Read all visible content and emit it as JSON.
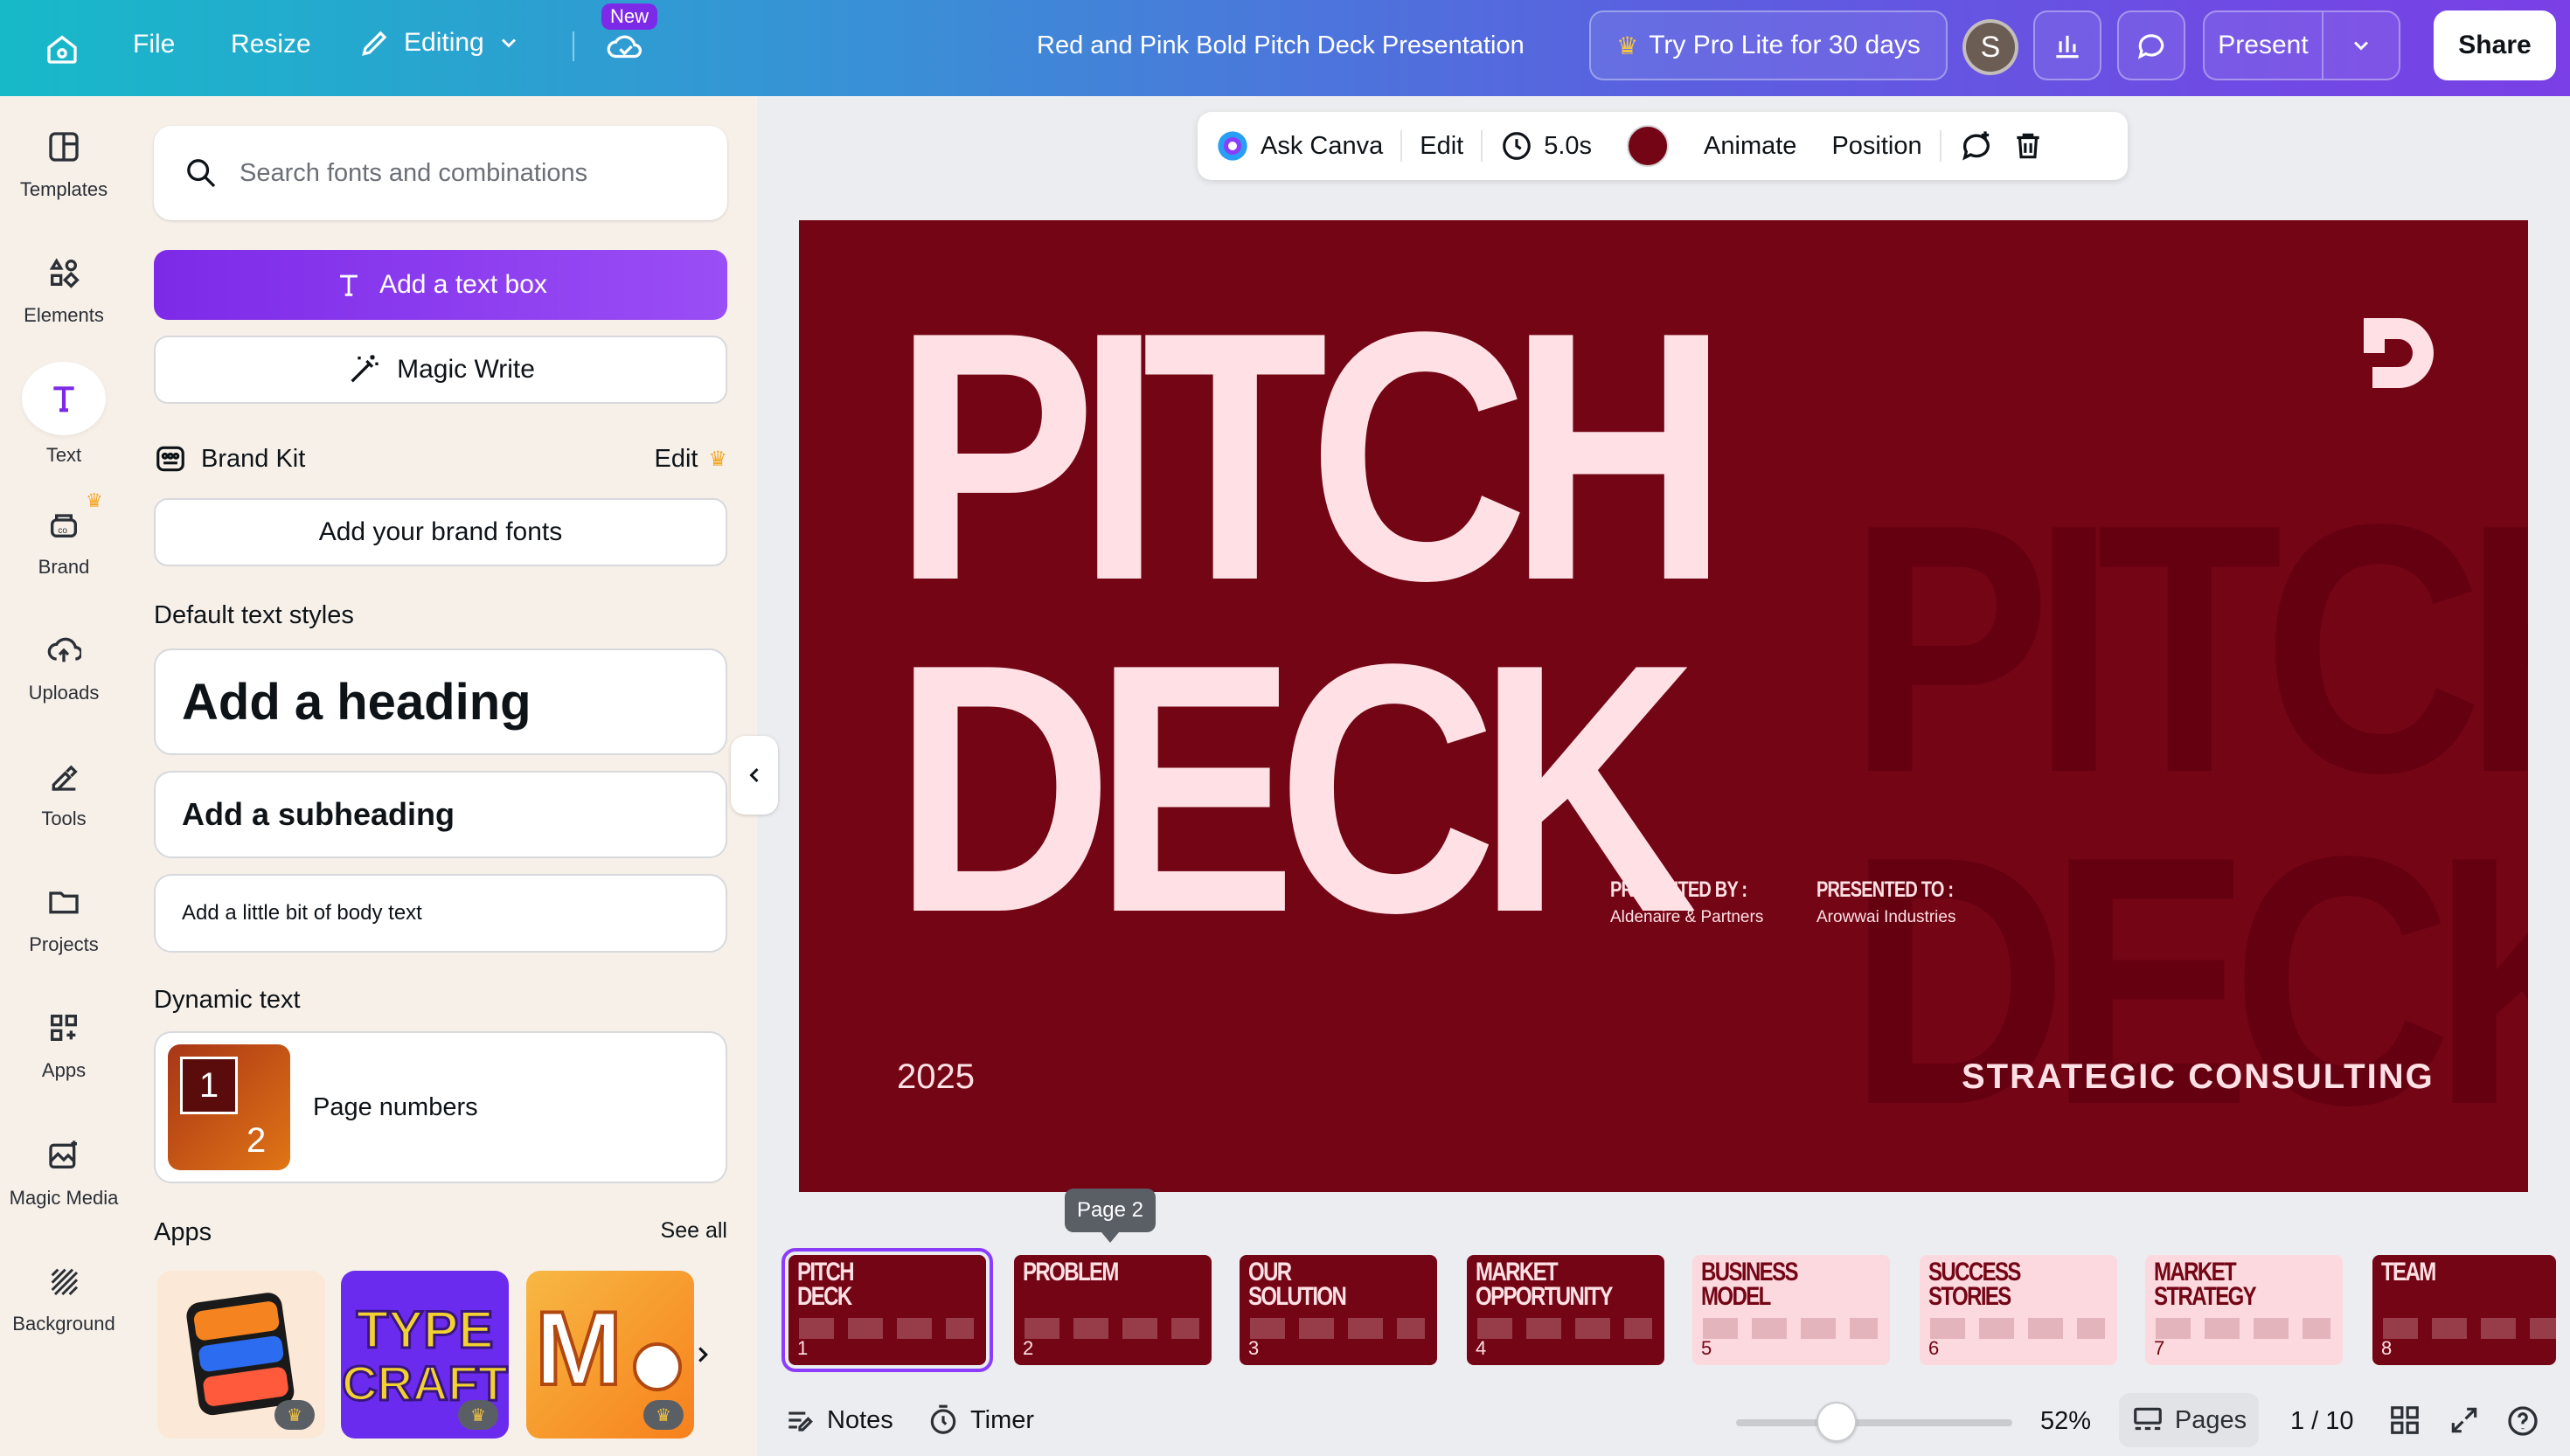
{
  "topbar": {
    "file_label": "File",
    "resize_label": "Resize",
    "editing_label": "Editing",
    "new_badge": "New",
    "doc_title": "Red and Pink Bold Pitch Deck Presentation",
    "try_pro_label": "Try Pro Lite for 30 days",
    "avatar_initial": "S",
    "present_label": "Present",
    "share_label": "Share"
  },
  "rail": {
    "items": [
      {
        "label": "Templates",
        "icon": "templates-icon"
      },
      {
        "label": "Elements",
        "icon": "elements-icon"
      },
      {
        "label": "Text",
        "icon": "text-icon"
      },
      {
        "label": "Brand",
        "icon": "brand-icon"
      },
      {
        "label": "Uploads",
        "icon": "uploads-icon"
      },
      {
        "label": "Tools",
        "icon": "tools-icon"
      },
      {
        "label": "Projects",
        "icon": "projects-icon"
      },
      {
        "label": "Apps",
        "icon": "apps-icon"
      },
      {
        "label": "Magic Media",
        "icon": "magic-media-icon"
      },
      {
        "label": "Background",
        "icon": "background-icon"
      }
    ]
  },
  "panel": {
    "search_placeholder": "Search fonts and combinations",
    "add_text_box": "Add a text box",
    "magic_write": "Magic Write",
    "brand_kit": "Brand Kit",
    "brand_edit": "Edit",
    "add_brand_fonts": "Add your brand fonts",
    "default_styles_title": "Default text styles",
    "heading": "Add a heading",
    "subheading": "Add a subheading",
    "body": "Add a little bit of body text",
    "dynamic_title": "Dynamic text",
    "page_numbers": "Page numbers",
    "page_thumb_1": "1",
    "page_thumb_2": "2",
    "apps_title": "Apps",
    "see_all": "See all"
  },
  "context_bar": {
    "ask_canva": "Ask Canva",
    "edit": "Edit",
    "duration": "5.0s",
    "animate": "Animate",
    "position": "Position",
    "color": "#740515"
  },
  "slide": {
    "title_line1": "PITCH",
    "title_line2": "DECK",
    "presented_by_label": "PRESENTED BY :",
    "presented_by_value": "Aldenaire & Partners",
    "presented_to_label": "PRESENTED TO :",
    "presented_to_value": "Arowwai Industries",
    "year": "2025",
    "tagline": "STRATEGIC CONSULTING",
    "bg_color": "#740515",
    "text_color": "#ffe1e5"
  },
  "thumbnails": {
    "tooltip": "Page 2",
    "pages": [
      {
        "num": "1",
        "title": "PITCH\nDECK",
        "theme": "dark"
      },
      {
        "num": "2",
        "title": "PROBLEM",
        "theme": "dark"
      },
      {
        "num": "3",
        "title": "OUR\nSOLUTION",
        "theme": "dark"
      },
      {
        "num": "4",
        "title": "MARKET\nOPPORTUNITY",
        "theme": "dark"
      },
      {
        "num": "5",
        "title": "BUSINESS\nMODEL",
        "theme": "light"
      },
      {
        "num": "6",
        "title": "SUCCESS\nSTORIES",
        "theme": "light"
      },
      {
        "num": "7",
        "title": "MARKET\nSTRATEGY",
        "theme": "light"
      },
      {
        "num": "8",
        "title": "TEAM",
        "theme": "dark"
      }
    ]
  },
  "bottombar": {
    "notes": "Notes",
    "timer": "Timer",
    "zoom": "52%",
    "zoom_fraction": 0.52,
    "pages": "Pages",
    "page_count": "1 / 10"
  }
}
